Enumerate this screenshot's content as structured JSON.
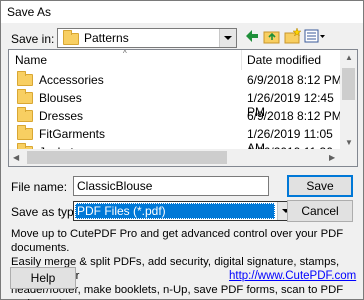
{
  "window": {
    "title": "Save As"
  },
  "save_in": {
    "label": "Save in:",
    "value": "Patterns"
  },
  "toolbar": {
    "icons": [
      "back-arrow-icon",
      "up-folder-icon",
      "new-folder-icon",
      "view-menu-icon"
    ]
  },
  "file_list": {
    "columns": [
      "Name",
      "Date modified"
    ],
    "rows": [
      {
        "name": "Accessories",
        "date": "6/9/2018 8:12 PM"
      },
      {
        "name": "Blouses",
        "date": "1/26/2019 12:45 PM"
      },
      {
        "name": "Dresses",
        "date": "6/9/2018 8:12 PM"
      },
      {
        "name": "FitGarments",
        "date": "1/26/2019 11:05 AM"
      },
      {
        "name": "Jackets",
        "date": "1/26/2019 11:36 AM"
      }
    ]
  },
  "file_name": {
    "label": "File name:",
    "value": "ClassicBlouse"
  },
  "save_as_type": {
    "label": "Save as type:",
    "value": "PDF Files (*.pdf)"
  },
  "buttons": {
    "save": "Save",
    "cancel": "Cancel",
    "help": "Help"
  },
  "promo": {
    "line1": "Move up to CutePDF Pro and get advanced control over your PDF documents.",
    "line2": "Easily merge & split PDFs, add security, digital signature, stamps, bookmarks or",
    "line3": "header/footer, make booklets, n-Up, save PDF forms, scan to PDF and more!",
    "link": "http://www.CutePDF.com"
  },
  "colors": {
    "selection": "#0078d7",
    "folder": "#f8cf62",
    "link": "#0000ff"
  }
}
